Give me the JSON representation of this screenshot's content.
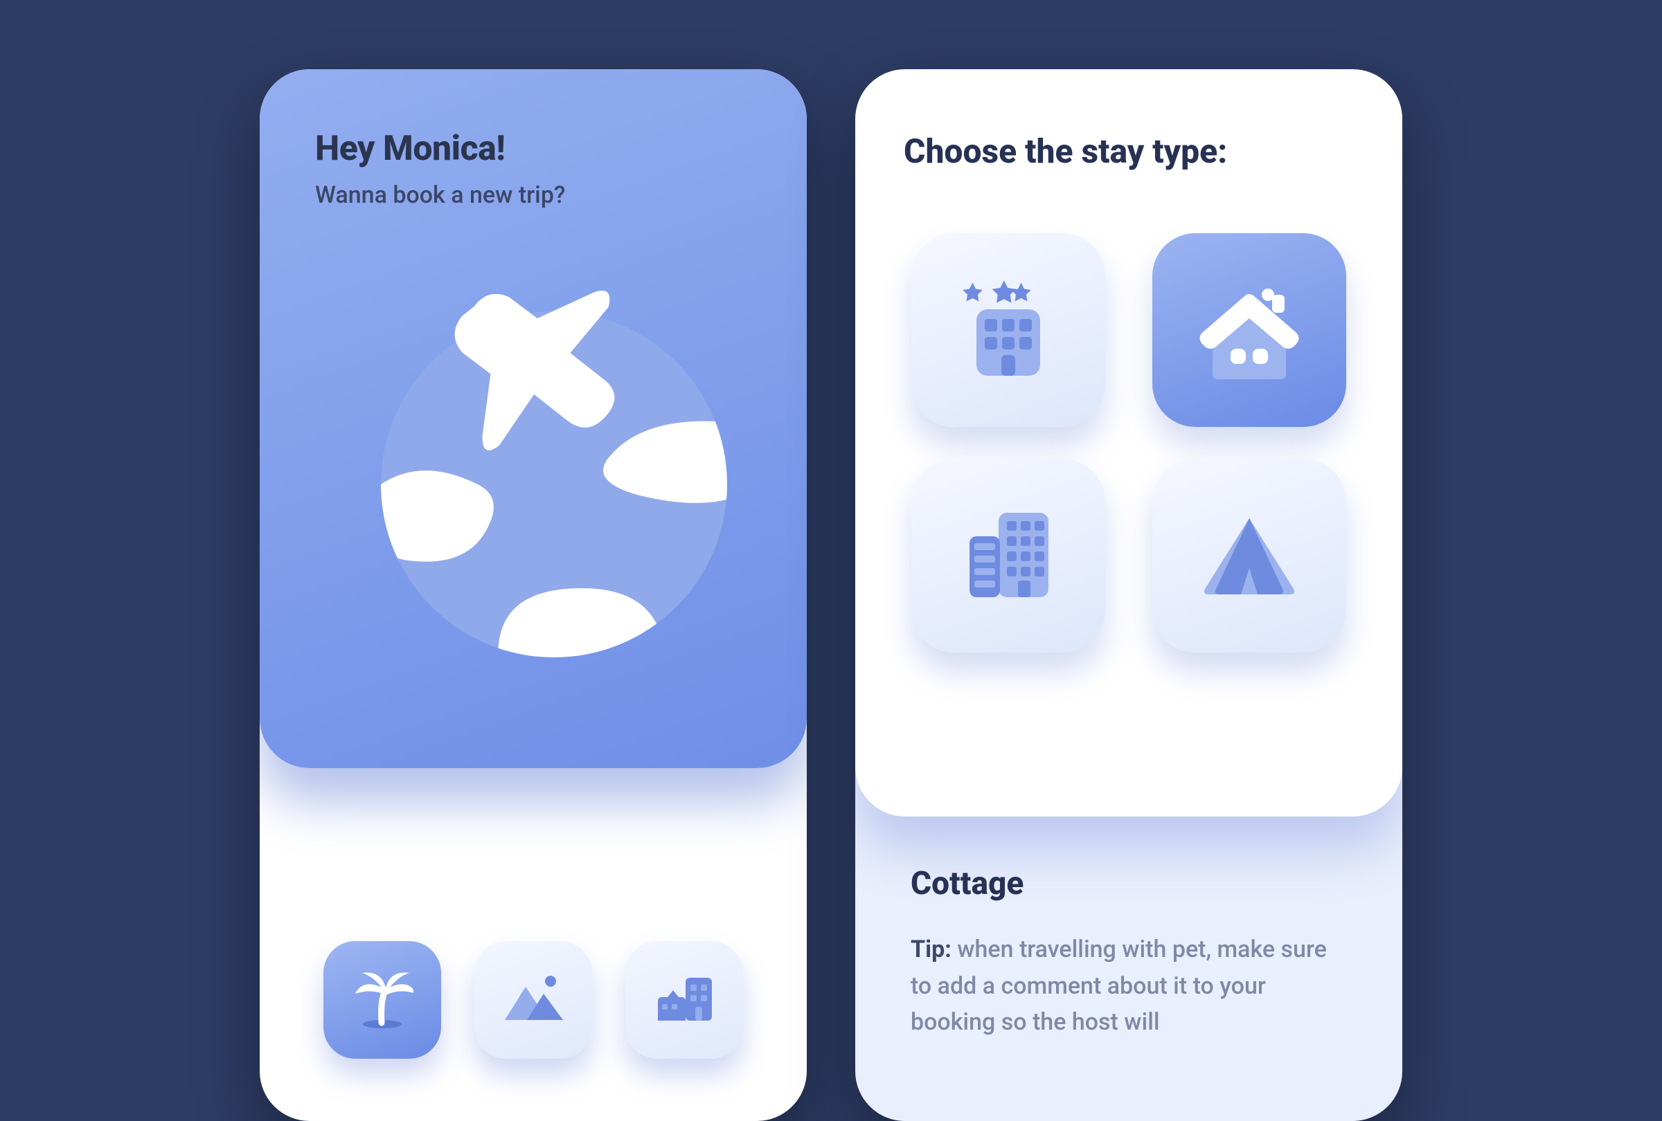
{
  "left": {
    "greeting": "Hey Monica!",
    "subtitle": "Wanna book a new trip?",
    "categories": [
      {
        "icon": "palm-tree-icon",
        "active": true
      },
      {
        "icon": "mountains-icon",
        "active": false
      },
      {
        "icon": "city-icon",
        "active": false
      }
    ]
  },
  "right": {
    "title": "Choose the stay type:",
    "stay_types": [
      {
        "icon": "hotel-icon",
        "selected": false
      },
      {
        "icon": "cottage-icon",
        "selected": true
      },
      {
        "icon": "apartment-icon",
        "selected": false
      },
      {
        "icon": "tent-icon",
        "selected": false
      }
    ],
    "selection_label": "Cottage",
    "tip_prefix": "Tip:",
    "tip_body": " when travelling with pet, make sure to add a comment about it to your booking so the host will"
  },
  "colors": {
    "bg": "#2d3c64",
    "accent_from": "#9cb4f1",
    "accent_to": "#6a8be6",
    "text_dark": "#273154"
  }
}
